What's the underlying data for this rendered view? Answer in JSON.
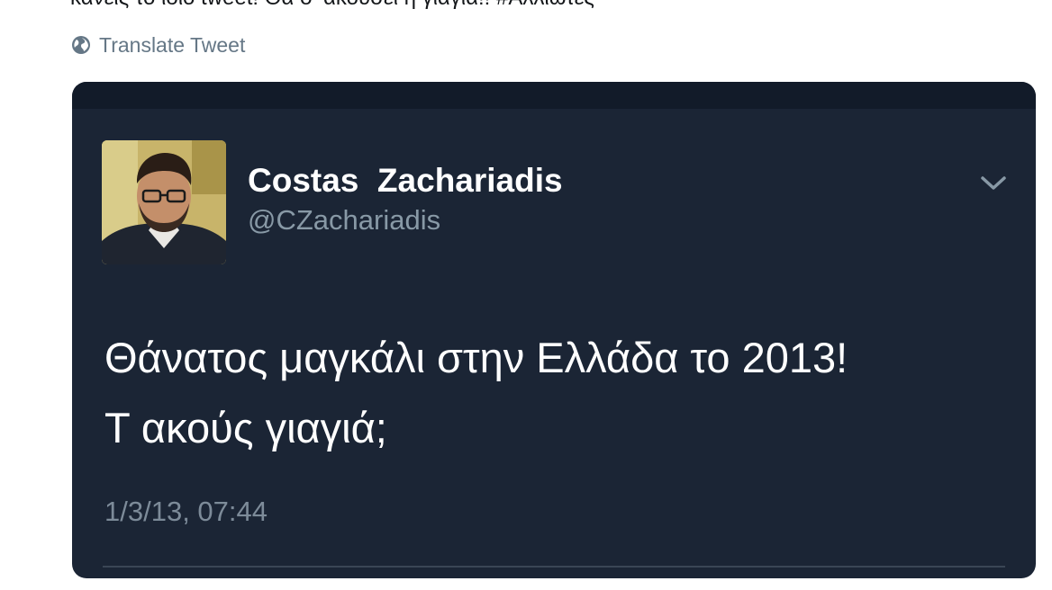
{
  "top_text": "κανείς το ίδιο tweet! Θα σ' ακούσει η γιαγιά!! #Αλλιώτες",
  "translate": {
    "label": "Translate Tweet",
    "icon": "globe-icon"
  },
  "embedded_tweet": {
    "display_name": "Costas  Zachariadis",
    "handle": "@CZachariadis",
    "text_lines": [
      "Θάνατος μαγκάλι στην Ελλάδα το 2013!",
      "Τ ακούς γιαγιά;"
    ],
    "timestamp": "1/3/13, 07:44",
    "menu_icon": "chevron-down-icon"
  },
  "colors": {
    "card_background": "#1b2535",
    "name_text": "#ffffff",
    "secondary_text": "#8899a6",
    "translate_text": "#657786"
  }
}
